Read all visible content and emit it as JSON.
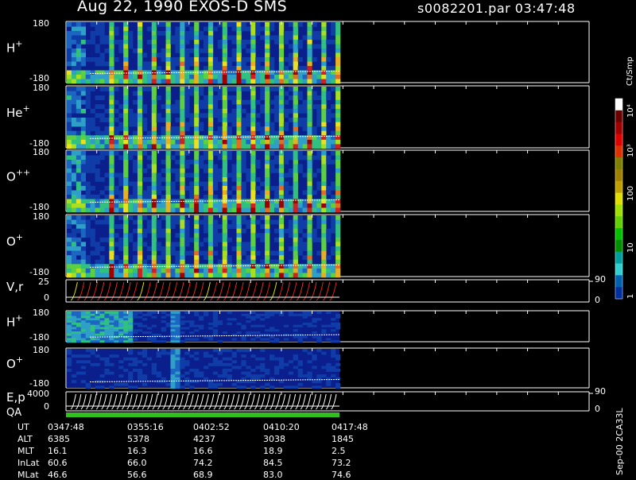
{
  "header": {
    "left": "Aug 22, 1990    EXOS-D SMS",
    "right": "s0082201.par  03:47:48"
  },
  "panels": [
    {
      "label": "H",
      "sup": "+",
      "ytop": "180",
      "ybot": "-180",
      "kind": "spec"
    },
    {
      "label": "He",
      "sup": "+",
      "ytop": "180",
      "ybot": "-180",
      "kind": "spec"
    },
    {
      "label": "O",
      "sup": "++",
      "ytop": "180",
      "ybot": "-180",
      "kind": "spec"
    },
    {
      "label": "O",
      "sup": "+",
      "ytop": "180",
      "ybot": "-180",
      "kind": "spec"
    },
    {
      "label": "V,r",
      "sup": "",
      "ytop": "25",
      "ybot": "0",
      "kind": "line",
      "rtop": "90",
      "rbot": "0"
    },
    {
      "label": "H",
      "sup": "+",
      "ytop": "180",
      "ybot": "-180",
      "kind": "spec2"
    },
    {
      "label": "O",
      "sup": "+",
      "ytop": "180",
      "ybot": "-180",
      "kind": "spec2"
    },
    {
      "label": "E,p",
      "sup": "",
      "ytop": "4000",
      "ybot": "0",
      "kind": "line2",
      "rtop": "90",
      "rbot": "0"
    }
  ],
  "qa_label": "QA",
  "colorbar": {
    "unit": "Ct/Smp",
    "ticks": [
      "10⁴",
      "10³",
      "100",
      "10",
      "1"
    ],
    "colors": [
      "#ffffff",
      "#6b0000",
      "#a00000",
      "#e00000",
      "#e03000",
      "#808000",
      "#a08000",
      "#c0a000",
      "#e0e000",
      "#a0e000",
      "#60d000",
      "#00c000",
      "#009000",
      "#00a0a0",
      "#30d0d0",
      "#0060b0",
      "#0030a0"
    ]
  },
  "footer": {
    "rows": [
      {
        "label": "UT",
        "values": [
          "0347:48",
          "0355:16",
          "0402:52",
          "0410:20",
          "0417:48"
        ]
      },
      {
        "label": "ALT",
        "values": [
          "6385",
          "5378",
          "4237",
          "3038",
          "1845"
        ]
      },
      {
        "label": "MLT",
        "values": [
          "16.1",
          "16.3",
          "16.6",
          "18.9",
          "2.5"
        ]
      },
      {
        "label": "InLat",
        "values": [
          "60.6",
          "66.0",
          "74.2",
          "84.5",
          "73.2"
        ]
      },
      {
        "label": "MLat",
        "values": [
          "46.6",
          "56.6",
          "68.9",
          "83.0",
          "74.6"
        ]
      }
    ],
    "stamp": "Sep-00 2CA33L"
  },
  "chart_data": {
    "type": "heatmap",
    "x": [
      "0347:48",
      "0355:16",
      "0402:52",
      "0410:20",
      "0417:48"
    ],
    "colors": {
      "background": "#000000",
      "low": "#0a2a8a",
      "high": "#d02020"
    }
  }
}
